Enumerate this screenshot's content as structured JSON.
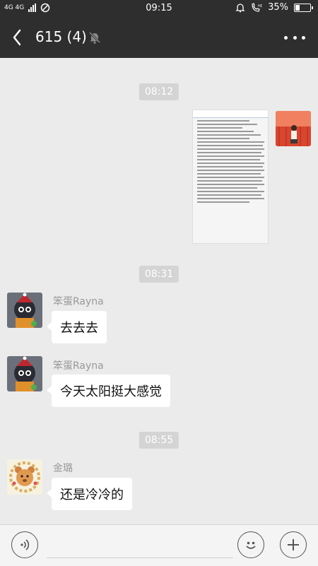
{
  "status_bar": {
    "network": "4G 4G",
    "time": "09:15",
    "battery": "35%",
    "battery_level": 0.35
  },
  "header": {
    "title": "615 (4)"
  },
  "messages": {
    "time_1": "08:12",
    "time_2": "08:31",
    "time_3": "08:55",
    "msg1": {
      "sender": "笨蛋Rayna",
      "text": "去去去"
    },
    "msg2": {
      "sender": "笨蛋Rayna",
      "text": "今天太阳挺大感觉"
    },
    "msg3": {
      "sender": "金璐",
      "text": "还是冷冷的"
    }
  },
  "icons": {
    "back": "back-arrow-icon",
    "mute": "muted-bell-icon",
    "more": "more-dots-icon",
    "voice": "voice-icon",
    "emoji": "emoji-icon",
    "add": "plus-icon"
  },
  "colors": {
    "header_bg": "#2e2e2e",
    "chat_bg": "#ebebeb",
    "bubble_bg": "#ffffff",
    "timestamp_bg": "#d4d4d4"
  }
}
